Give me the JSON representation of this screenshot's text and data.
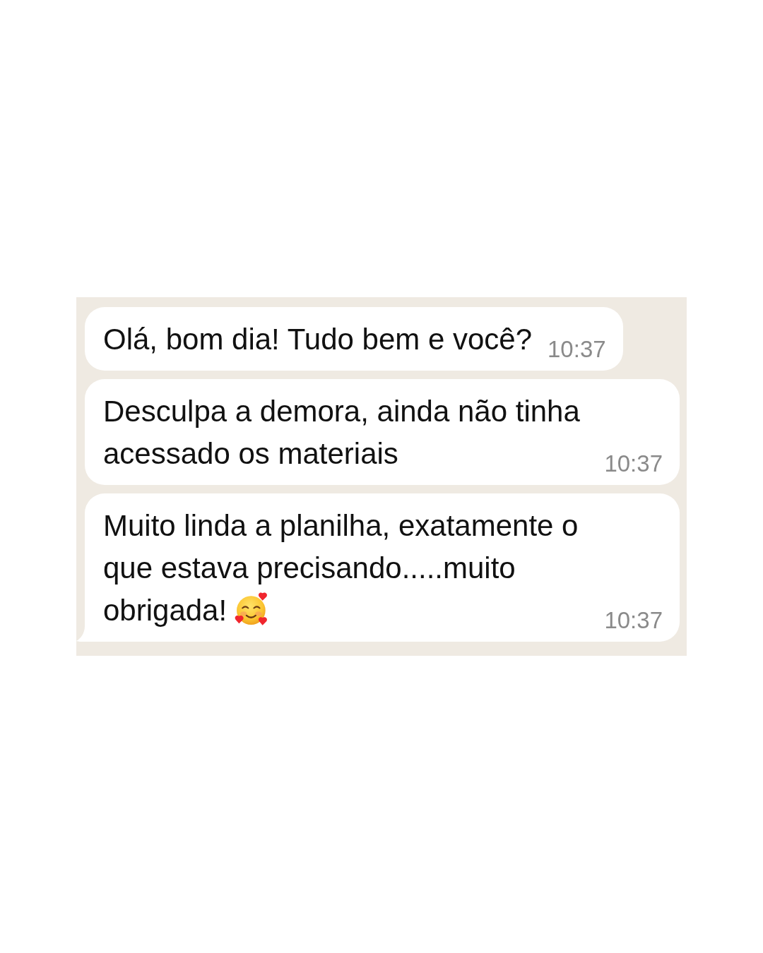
{
  "messages": [
    {
      "text": "Olá, bom dia! Tudo bem e você?",
      "emoji": false,
      "time": "10:37",
      "tail": false
    },
    {
      "text": "Desculpa a demora, ainda não tinha acessado os materiais",
      "emoji": false,
      "time": "10:37",
      "tail": false
    },
    {
      "text": "Muito linda a planilha, exatamente o que estava precisando.....muito obrigada!",
      "emoji": true,
      "time": "10:37",
      "tail": true
    }
  ]
}
